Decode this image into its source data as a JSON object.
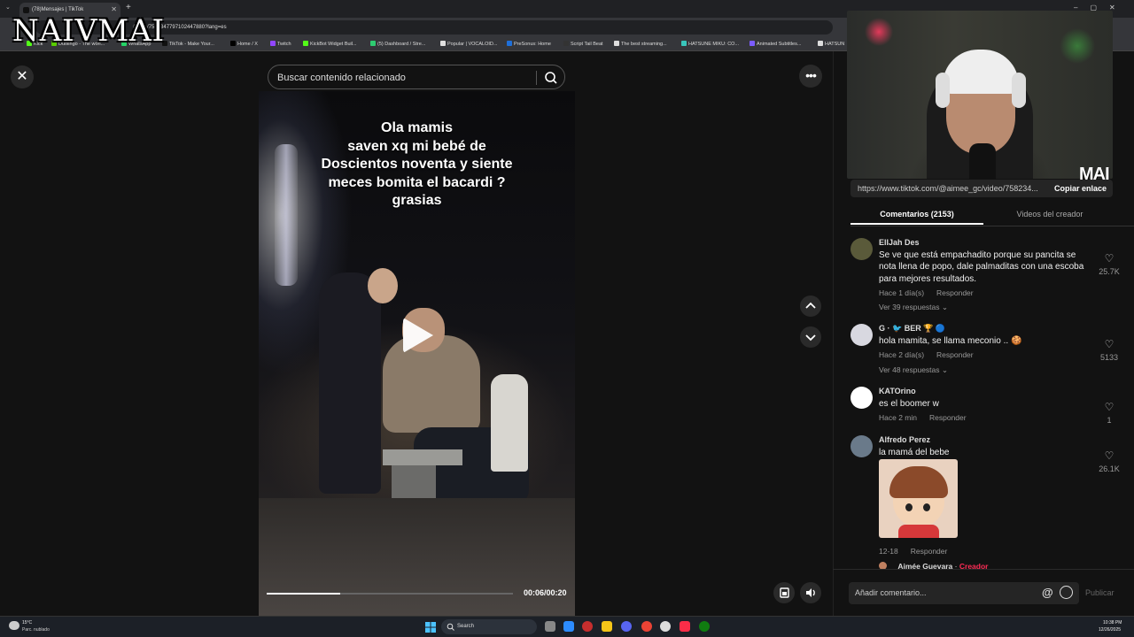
{
  "browser": {
    "tab_title": "(78)Mensajes | TikTok",
    "url": "/video/7582347797102447880?lang=es",
    "bookmarks": [
      {
        "label": "Kick",
        "color": "#53fc18"
      },
      {
        "label": "Duolingo - The worl...",
        "color": "#58cc02"
      },
      {
        "label": "WhatsApp",
        "color": "#25d366"
      },
      {
        "label": "TikTok - Make Your...",
        "color": "#111111"
      },
      {
        "label": "Home / X",
        "color": "#000000"
      },
      {
        "label": "Twitch",
        "color": "#9146ff"
      },
      {
        "label": "KickBot Widget Buil...",
        "color": "#53fc18"
      },
      {
        "label": "(5) Dashboard / Stre...",
        "color": "#2ecc71"
      },
      {
        "label": "Popular | VOCALOID...",
        "color": "#e0e0e0"
      },
      {
        "label": "PreSonus: Home",
        "color": "#1e6fd9"
      },
      {
        "label": "Script Tail Beat",
        "color": "#333333"
      },
      {
        "label": "The best streaming...",
        "color": "#dddddd"
      },
      {
        "label": "HATSUNE MIKU: CO...",
        "color": "#39c5bb"
      },
      {
        "label": "Animated Subtitles...",
        "color": "#7b5cff"
      },
      {
        "label": "HATSUN",
        "color": "#dddddd"
      }
    ]
  },
  "watermark": "NAIVMAI",
  "search": {
    "placeholder": "Buscar contenido relacionado"
  },
  "video": {
    "caption": "Ola mamis\nsaven xq mi bebé de\nDoscientos noventa y siente\nmeces bomita el bacardi ?\ngrasias",
    "time": "00:06/00:20",
    "progress": 0.3
  },
  "webcam": {
    "label": "MAI"
  },
  "panel": {
    "link": "https://www.tiktok.com/@aimee_gc/video/758234...",
    "copy_link": "Copiar enlace",
    "tab_comments": "Comentarios (2153)",
    "tab_creator": "Videos del creador",
    "comments": [
      {
        "name": "ElIJah Des",
        "text": "Se ve que está empachadito porque su pancita se nota llena de popo, dale palmaditas con una escoba para mejores resultados.",
        "time": "Hace 1 día(s)",
        "reply": "Responder",
        "more": "Ver 39 respuestas",
        "likes": "25.7K",
        "avatar_color": "#5a5a3a"
      },
      {
        "name": "G · 🐦 BER 🏆 🔵",
        "text": "hola mamita, se llama meconio .. 🍪",
        "time": "Hace 2 día(s)",
        "reply": "Responder",
        "more": "Ver 48 respuestas",
        "likes": "5133",
        "avatar_color": "#d8d8e0"
      },
      {
        "name": "KATOrino",
        "text": "es el boomer w",
        "time": "Hace 2 min",
        "reply": "Responder",
        "likes": "1",
        "avatar_color": "#ffffff"
      },
      {
        "name": "Alfredo Perez",
        "text": "la mamá del bebe",
        "time": "12-18",
        "reply": "Responder",
        "likes": "26.1K",
        "avatar_color": "#6a7a8a"
      }
    ],
    "creator_reply": {
      "name": "Aimée Guevara",
      "badge": "Creador"
    },
    "comment_placeholder": "Añadir comentario...",
    "post": "Publicar"
  },
  "taskbar": {
    "temp": "15°C",
    "condition": "Parc. nublado",
    "search": "Search",
    "time": "10:38 PM",
    "date": "12/26/2025"
  },
  "colors": {
    "creator_badge": "#fe2c55",
    "accent": "#ffffff"
  }
}
